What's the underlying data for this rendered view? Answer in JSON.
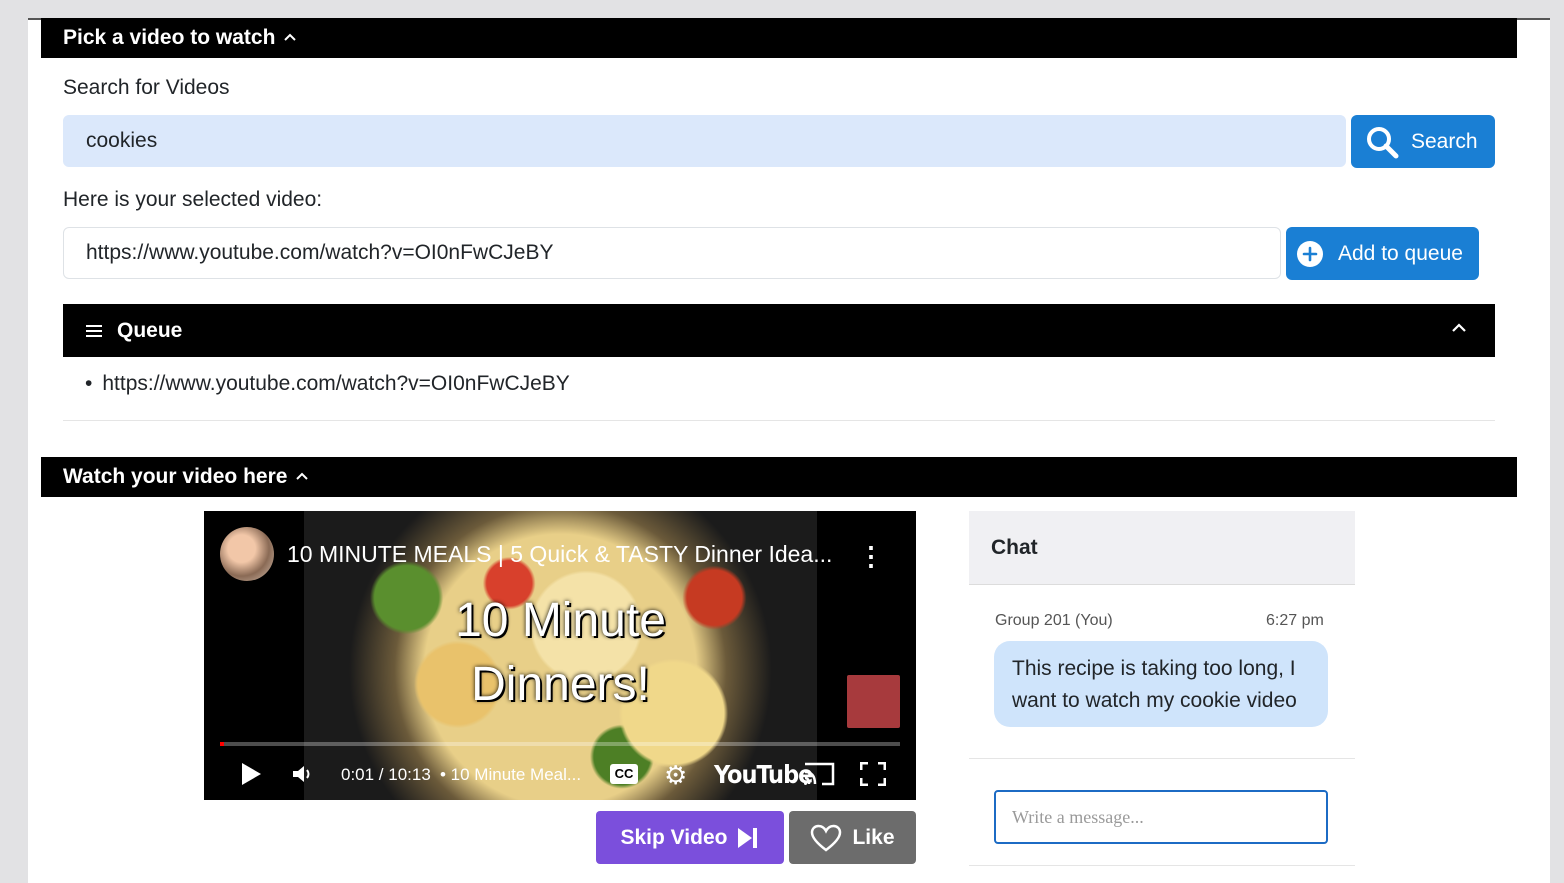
{
  "pick_section": {
    "title": "Pick a video to watch"
  },
  "search": {
    "label": "Search for Videos",
    "value": "cookies",
    "button_label": "Search"
  },
  "selected": {
    "label": "Here is your selected video:",
    "value": "https://www.youtube.com/watch?v=OI0nFwCJeBY",
    "button_label": "Add to queue"
  },
  "queue": {
    "title": "Queue",
    "items": [
      "https://www.youtube.com/watch?v=OI0nFwCJeBY"
    ]
  },
  "watch_section": {
    "title": "Watch your video here"
  },
  "player": {
    "video_title": "10 MINUTE MEALS | 5 Quick & TASTY Dinner Idea...",
    "thumbnail_line1": "10 Minute",
    "thumbnail_line2": "Dinners!",
    "time": "0:01 / 10:13",
    "chapter": "• 10 Minute Meal...",
    "cc_label": "CC",
    "youtube_label": "YouTube"
  },
  "actions": {
    "skip_label": "Skip Video",
    "like_label": "Like"
  },
  "chat": {
    "title": "Chat",
    "message": {
      "sender": "Group 201 (You)",
      "time": "6:27 pm",
      "text": "This recipe is taking too long, I want to watch my cookie video"
    },
    "input_placeholder": "Write a message..."
  },
  "colors": {
    "primary": "#1a7fd4",
    "skip": "#7b4fdc",
    "like": "#6c6c6c",
    "bubble": "#cfe4fb",
    "search_input_bg": "#dbe8fb"
  }
}
